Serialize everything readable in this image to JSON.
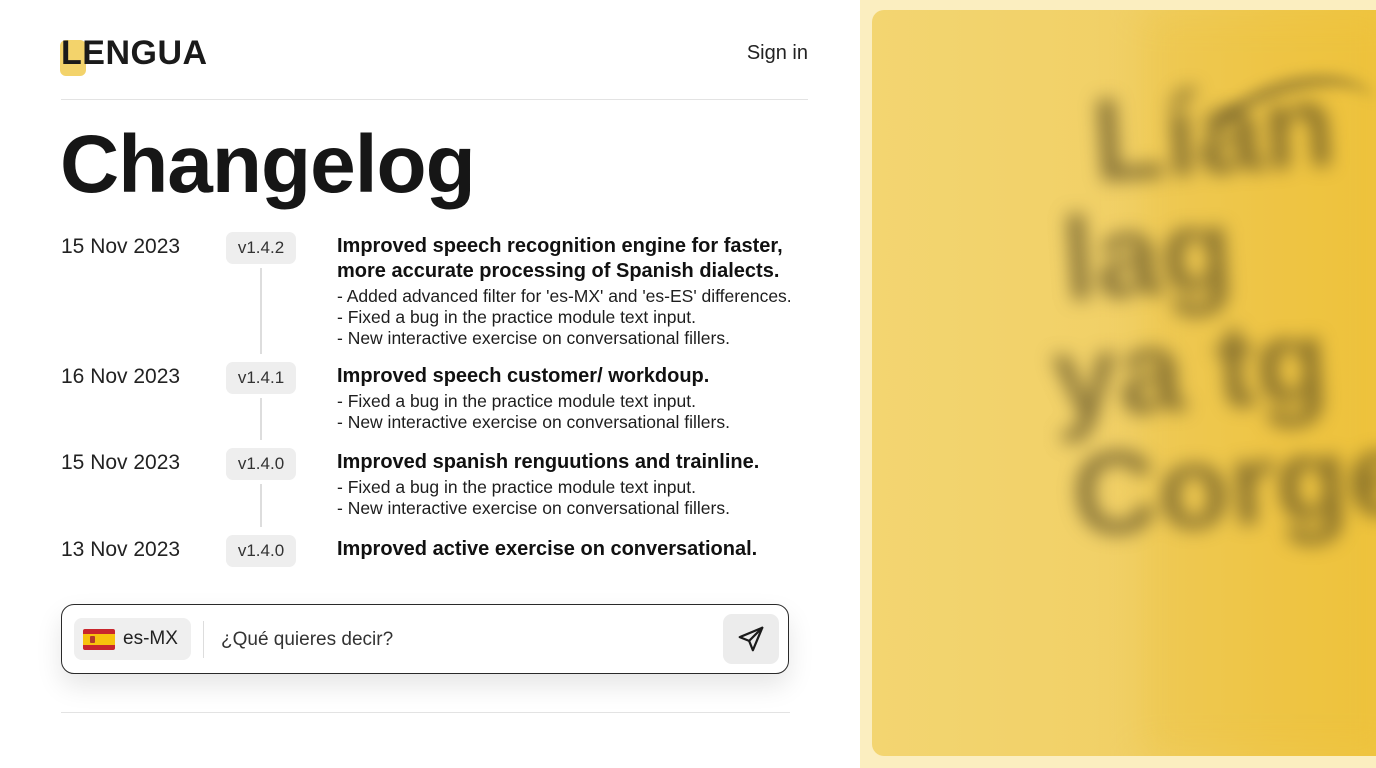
{
  "header": {
    "logo_text": "LENGUA",
    "signin_label": "Sign in"
  },
  "page": {
    "title": "Changelog"
  },
  "changelog": [
    {
      "date": "15 Nov 2023",
      "version": "v1.4.2",
      "title_lines": [
        "Improved speech recognition engine for faster,",
        "more accurate processing of Spanish dialects."
      ],
      "bullets": [
        "- Added advanced filter for 'es-MX' and 'es-ES' differences.",
        "- Fixed a bug in the practice module text input.",
        "- New interactive exercise on conversational fillers."
      ]
    },
    {
      "date": "16 Nov 2023",
      "version": "v1.4.1",
      "title_lines": [
        "Improved speech customer/ workdoup."
      ],
      "bullets": [
        "- Fixed a bug in the practice module text input.",
        "- New interactive exercise on conversational fillers."
      ]
    },
    {
      "date": "15 Nov 2023",
      "version": "v1.4.0",
      "title_lines": [
        "Improved spanish renguutions and trainline."
      ],
      "bullets": [
        "- Fixed a bug in the practice module text input.",
        "- New interactive exercise on conversational fillers."
      ]
    },
    {
      "date": "13 Nov 2023",
      "version": "v1.4.0",
      "title_lines": [
        "Improved active exercise on conversational."
      ],
      "bullets": []
    }
  ],
  "composer": {
    "language_label": "es-MX",
    "language_flag": "spain-flag-icon",
    "placeholder": "¿Qué quieres decir?",
    "send_icon": "send-icon"
  },
  "art": {
    "blurred_text_lines": [
      "Lían",
      "lag",
      "ya tg",
      "Corge"
    ]
  },
  "colors": {
    "accent_yellow": "#f3d36b",
    "art_panel_bg": "#fbeec0",
    "text_primary": "#111111",
    "version_badge_bg": "#eeeeee"
  }
}
